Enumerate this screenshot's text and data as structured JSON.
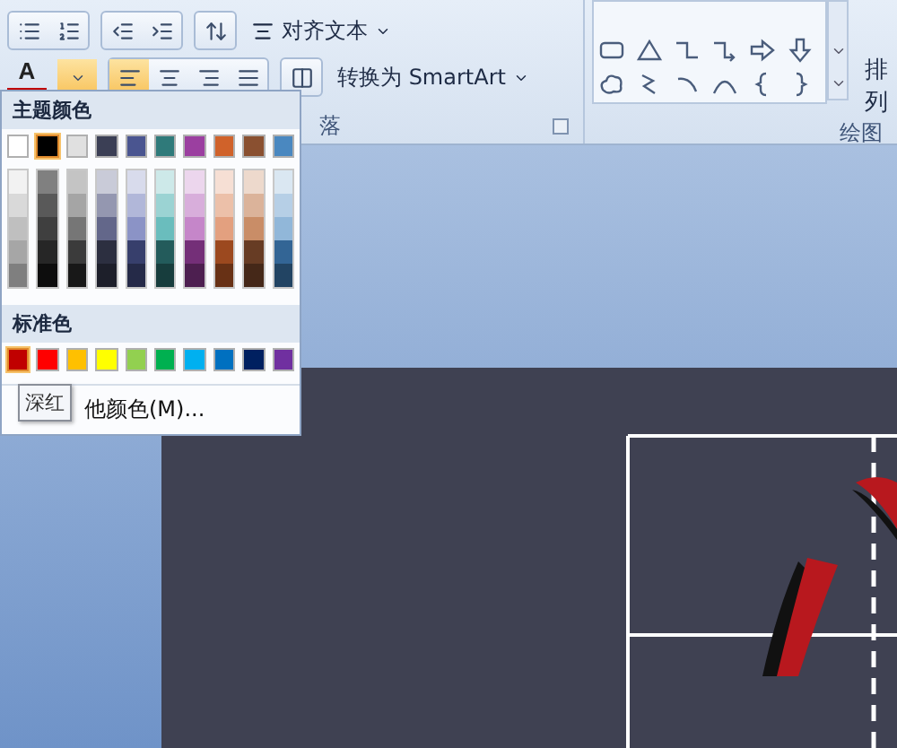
{
  "ribbon": {
    "align_text": "对齐文本",
    "smartart": "转换为 SmartArt",
    "paragraph_group_label": "落",
    "drawing_group_label": "绘图",
    "arrange": "排列",
    "font_color_glyph": "A"
  },
  "color_menu": {
    "theme_heading": "主题颜色",
    "theme_colors": [
      {
        "color": "#ffffff",
        "selected": false,
        "shades": [
          {
            "color": "#f2f2f2"
          },
          {
            "color": "#d9d9d9"
          },
          {
            "color": "#bfbfbf"
          },
          {
            "color": "#a6a6a6"
          },
          {
            "color": "#7f7f7f"
          }
        ]
      },
      {
        "color": "#000000",
        "selected": true,
        "shades": [
          {
            "color": "#808080"
          },
          {
            "color": "#595959"
          },
          {
            "color": "#3f3f3f"
          },
          {
            "color": "#262626"
          },
          {
            "color": "#0d0d0d"
          }
        ]
      },
      {
        "color": "#e0e0e0",
        "selected": false,
        "shades": [
          {
            "color": "#c4c4c4"
          },
          {
            "color": "#a5a5a5"
          },
          {
            "color": "#767676"
          },
          {
            "color": "#3b3b3b"
          },
          {
            "color": "#181818"
          }
        ]
      },
      {
        "color": "#3b3f55",
        "selected": false,
        "shades": [
          {
            "color": "#c9cbd8"
          },
          {
            "color": "#9497b0"
          },
          {
            "color": "#63678a"
          },
          {
            "color": "#2c2f40"
          },
          {
            "color": "#1d1f2a"
          }
        ]
      },
      {
        "color": "#4a5590",
        "selected": false,
        "shades": [
          {
            "color": "#d8dbec"
          },
          {
            "color": "#b1b7d9"
          },
          {
            "color": "#8b93c6"
          },
          {
            "color": "#373f6c"
          },
          {
            "color": "#252a48"
          }
        ]
      },
      {
        "color": "#2f7a7a",
        "selected": false,
        "shades": [
          {
            "color": "#cde9e9"
          },
          {
            "color": "#9bd3d3"
          },
          {
            "color": "#6abdbd"
          },
          {
            "color": "#235b5b"
          },
          {
            "color": "#173d3d"
          }
        ]
      },
      {
        "color": "#9b3fa0",
        "selected": false,
        "shades": [
          {
            "color": "#ecd6ed"
          },
          {
            "color": "#d8aedb"
          },
          {
            "color": "#c586c9"
          },
          {
            "color": "#742f78"
          },
          {
            "color": "#4d1f50"
          }
        ]
      },
      {
        "color": "#d0622a",
        "selected": false,
        "shades": [
          {
            "color": "#f6dfd4"
          },
          {
            "color": "#ecc0a9"
          },
          {
            "color": "#e3a07f"
          },
          {
            "color": "#9c491f"
          },
          {
            "color": "#683115"
          }
        ]
      },
      {
        "color": "#8a5030",
        "selected": false,
        "shades": [
          {
            "color": "#edd9cc"
          },
          {
            "color": "#dbb39a"
          },
          {
            "color": "#c98d67"
          },
          {
            "color": "#673c24"
          },
          {
            "color": "#452818"
          }
        ]
      },
      {
        "color": "#4a88c0",
        "selected": false,
        "shades": [
          {
            "color": "#dae7f2"
          },
          {
            "color": "#b6cfe6"
          },
          {
            "color": "#91b7d9"
          },
          {
            "color": "#336595"
          },
          {
            "color": "#224463"
          }
        ]
      }
    ],
    "standard_heading": "标准色",
    "standard_colors": [
      {
        "color": "#c00000",
        "hovered": true
      },
      {
        "color": "#ff0000",
        "hovered": false
      },
      {
        "color": "#ffc000",
        "hovered": false
      },
      {
        "color": "#ffff00",
        "hovered": false
      },
      {
        "color": "#92d050",
        "hovered": false
      },
      {
        "color": "#00b050",
        "hovered": false
      },
      {
        "color": "#00b0f0",
        "hovered": false
      },
      {
        "color": "#0070c0",
        "hovered": false
      },
      {
        "color": "#002060",
        "hovered": false
      },
      {
        "color": "#7030a0",
        "hovered": false
      }
    ],
    "more_colors": "他颜色(M)...",
    "tooltip": "深红"
  }
}
